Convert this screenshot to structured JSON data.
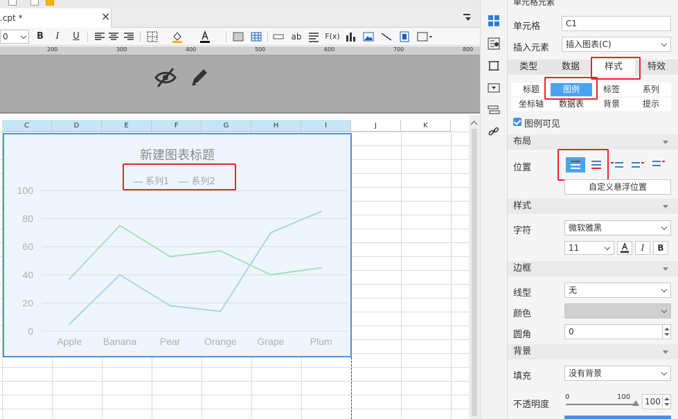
{
  "tab": {
    "label": ".cpt *",
    "close": "×"
  },
  "toolbar": {
    "font_size": "0",
    "bold": "B",
    "italic": "I",
    "underline": "U",
    "ab_label": "ab",
    "fx_label": "F(x)"
  },
  "ruler": {
    "marks": [
      "200",
      "300",
      "400",
      "500",
      "600",
      "700",
      "800"
    ]
  },
  "columns": [
    "C",
    "D",
    "E",
    "F",
    "G",
    "H",
    "I",
    "J",
    "K"
  ],
  "chart_data": {
    "type": "line",
    "title": "新建图表标题",
    "categories": [
      "Apple",
      "Banana",
      "Pear",
      "Orange",
      "Grape",
      "Plum"
    ],
    "series": [
      {
        "name": "系列1",
        "values": [
          5,
          40,
          18,
          14,
          70,
          85
        ],
        "color": "#a8d4ec"
      },
      {
        "name": "系列2",
        "values": [
          37,
          75,
          53,
          57,
          40,
          45
        ],
        "color": "#a6e0bd"
      }
    ],
    "yticks": [
      "0",
      "20",
      "40",
      "60",
      "80",
      "100"
    ],
    "ylim": [
      0,
      100
    ],
    "grid": true,
    "legend_position": "top"
  },
  "panel": {
    "header": "单元格元素",
    "cell_label": "单元格",
    "cell_value": "C1",
    "insert_label": "插入元素",
    "insert_value": "插入图表(C)",
    "tabs": [
      "类型",
      "数据",
      "样式",
      "特效"
    ],
    "subtabs_row1": [
      "标题",
      "图例",
      "标签",
      "系列"
    ],
    "subtabs_row2": [
      "坐标轴",
      "数据表",
      "背景",
      "提示"
    ],
    "legend_visible": "图例可见",
    "layout_section": "布局",
    "position_label": "位置",
    "custom_float": "自定义悬浮位置",
    "style_section": "样式",
    "char_label": "字符",
    "font_name": "微软雅黑",
    "font_size": "11",
    "italic": "I",
    "bold": "B",
    "border_section": "边框",
    "linetype_label": "线型",
    "linetype_value": "无",
    "color_label": "颜色",
    "radius_label": "圆角",
    "radius_value": "0",
    "bg_section": "背景",
    "fill_label": "填充",
    "fill_value": "没有背景",
    "opacity_label": "不透明度",
    "opacity_min": "0",
    "opacity_max": "100",
    "opacity_value": "100"
  }
}
